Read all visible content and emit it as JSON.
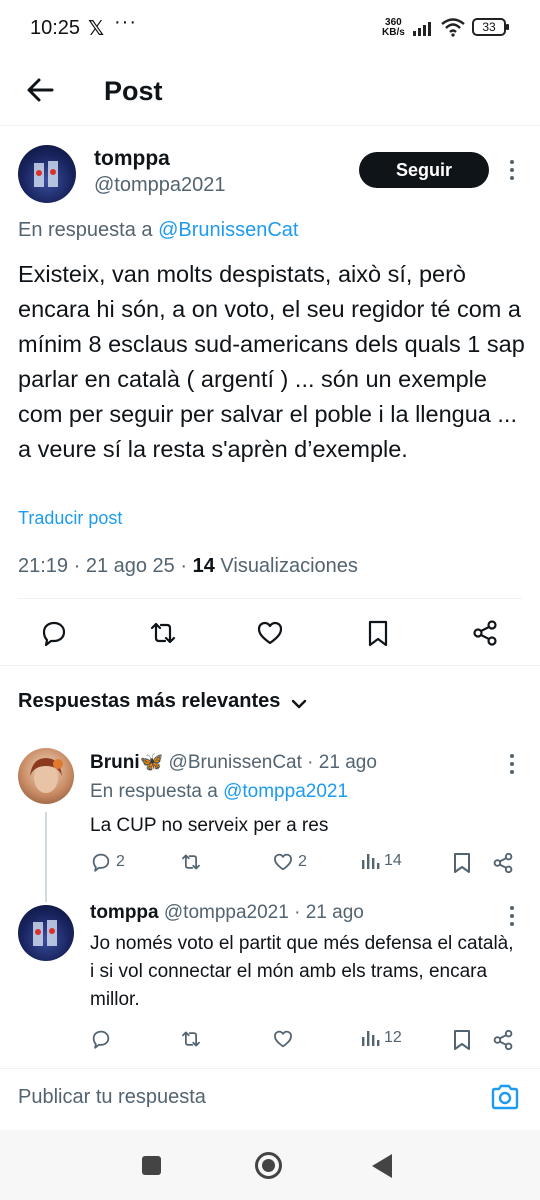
{
  "status_bar": {
    "time": "10:25",
    "x_icon": "x-logo-icon",
    "more": "···",
    "speed_value": "360",
    "speed_unit": "KB/s",
    "battery": "33"
  },
  "header": {
    "title": "Post",
    "back_icon": "arrow-left-icon"
  },
  "post": {
    "author_name": "tomppa",
    "author_handle": "@tomppa2021",
    "follow_label": "Seguir",
    "reply_to_prefix": "En respuesta a",
    "reply_to_handle": "@BrunissenCat",
    "text": "Existeix, van molts despistats, això sí, però encara hi són, a on voto, el seu regidor té com a mínim 8 esclaus sud-americans dels quals 1 sap parlar en català ( argentí ) ... són un exemple com per seguir per salvar el poble i la llengua ... a veure sí la resta s'aprèn d’exemple.",
    "translate_label": "Traducir post",
    "timestamp": "21:19 · 21 ago 25 ·",
    "views_count": "14",
    "views_label": "Visualizaciones"
  },
  "sort": {
    "label": "Respuestas más relevantes"
  },
  "replies": [
    {
      "name": "Bruni🦋",
      "handle": "@BrunissenCat",
      "time": "· 21 ago",
      "reply_to_prefix": "En respuesta a",
      "reply_to_handle": "@tomppa2021",
      "text": "La CUP no serveix per a res",
      "replies_count": "2",
      "reposts_count": "",
      "likes_count": "2",
      "views_count": "14"
    },
    {
      "name": "tomppa",
      "handle": "@tomppa2021",
      "time": "· 21 ago",
      "text": "Jo només voto el partit que més defensa el català, i si vol connectar el món amb els trams, encara millor.",
      "replies_count": "",
      "reposts_count": "",
      "likes_count": "",
      "views_count": "12"
    }
  ],
  "composer": {
    "placeholder": "Publicar tu respuesta"
  },
  "colors": {
    "link": "#1d9bf0",
    "muted": "#536471",
    "text": "#0f1419"
  }
}
